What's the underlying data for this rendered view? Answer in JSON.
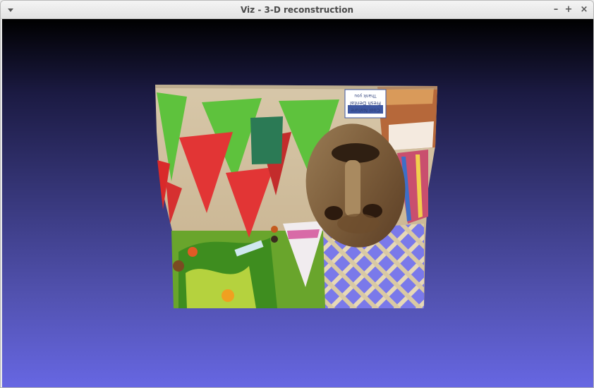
{
  "window": {
    "title": "Viz - 3-D reconstruction",
    "menu_icon": "chevron-down-icon",
    "minimize_label": "–",
    "maximize_label": "+",
    "close_label": "×"
  },
  "scene": {
    "sign_lines": [
      "Cool Nature",
      "Fresh Dental",
      "Thank you"
    ]
  }
}
